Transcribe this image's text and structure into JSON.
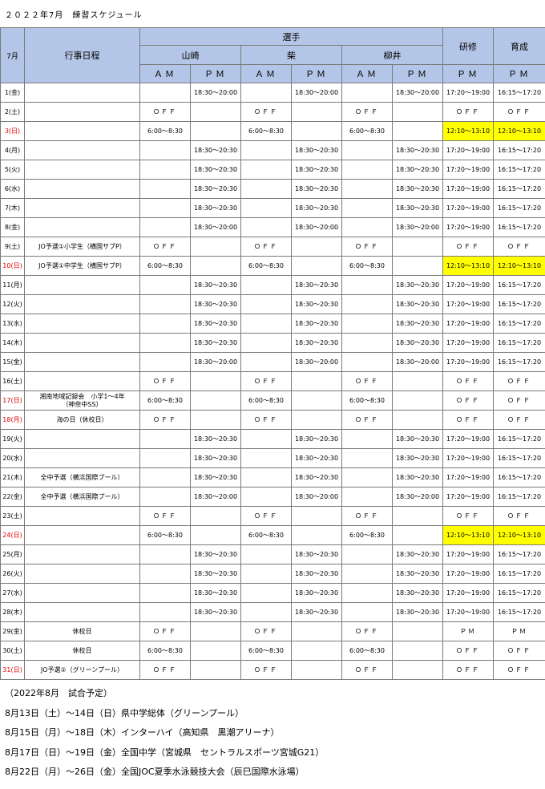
{
  "title": "２０２２年7月　練習スケジュール",
  "header": {
    "month": "7月",
    "events_col": "行事日程",
    "athletes": "選手",
    "names": [
      "山崎",
      "柴",
      "柳井"
    ],
    "training": "研修",
    "development": "育成",
    "am": "ＡＭ",
    "pm": "ＰＭ"
  },
  "rows": [
    {
      "date": "1(金)",
      "red": false,
      "event": "",
      "cells": [
        "",
        "18:30～20:00",
        "",
        "18:30～20:00",
        "",
        "18:30～20:00",
        "17:20～19:00",
        "16:15～17:20"
      ]
    },
    {
      "date": "2(土)",
      "red": false,
      "event": "",
      "cells": [
        "ＯＦＦ",
        "",
        "ＯＦＦ",
        "",
        "ＯＦＦ",
        "",
        "ＯＦＦ",
        "ＯＦＦ"
      ]
    },
    {
      "date": "3(日)",
      "red": true,
      "event": "",
      "cells": [
        "6:00～8:30",
        "",
        "6:00～8:30",
        "",
        "6:00～8:30",
        "",
        "12:10～13:10",
        "12:10～13:10"
      ],
      "yellow": true
    },
    {
      "date": "4(月)",
      "red": false,
      "event": "",
      "cells": [
        "",
        "18:30～20:30",
        "",
        "18:30～20:30",
        "",
        "18:30～20:30",
        "17:20～19:00",
        "16:15～17:20"
      ]
    },
    {
      "date": "5(火)",
      "red": false,
      "event": "",
      "cells": [
        "",
        "18:30～20:30",
        "",
        "18:30～20:30",
        "",
        "18:30～20:30",
        "17:20～19:00",
        "16:15～17:20"
      ]
    },
    {
      "date": "6(水)",
      "red": false,
      "event": "",
      "cells": [
        "",
        "18:30～20:30",
        "",
        "18:30～20:30",
        "",
        "18:30～20:30",
        "17:20～19:00",
        "16:15～17:20"
      ]
    },
    {
      "date": "7(木)",
      "red": false,
      "event": "",
      "cells": [
        "",
        "18:30～20:30",
        "",
        "18:30～20:30",
        "",
        "18:30～20:30",
        "17:20～19:00",
        "16:15～17:20"
      ]
    },
    {
      "date": "8(金)",
      "red": false,
      "event": "",
      "cells": [
        "",
        "18:30～20:00",
        "",
        "18:30～20:00",
        "",
        "18:30～20:00",
        "17:20～19:00",
        "16:15～17:20"
      ]
    },
    {
      "date": "9(土)",
      "red": false,
      "event": "JO予選①小学生（横国サブP）",
      "cells": [
        "ＯＦＦ",
        "",
        "ＯＦＦ",
        "",
        "ＯＦＦ",
        "",
        "ＯＦＦ",
        "ＯＦＦ"
      ]
    },
    {
      "date": "10(日)",
      "red": true,
      "event": "JO予選①中学生（横国サブP）",
      "cells": [
        "6:00～8:30",
        "",
        "6:00～8:30",
        "",
        "6:00～8:30",
        "",
        "12:10～13:10",
        "12:10～13:10"
      ],
      "yellow": true
    },
    {
      "date": "11(月)",
      "red": false,
      "event": "",
      "cells": [
        "",
        "18:30～20:30",
        "",
        "18:30～20:30",
        "",
        "18:30～20:30",
        "17:20～19:00",
        "16:15～17:20"
      ]
    },
    {
      "date": "12(火)",
      "red": false,
      "event": "",
      "cells": [
        "",
        "18:30～20:30",
        "",
        "18:30～20:30",
        "",
        "18:30～20:30",
        "17:20～19:00",
        "16:15～17:20"
      ]
    },
    {
      "date": "13(水)",
      "red": false,
      "event": "",
      "cells": [
        "",
        "18:30～20:30",
        "",
        "18:30～20:30",
        "",
        "18:30～20:30",
        "17:20～19:00",
        "16:15～17:20"
      ]
    },
    {
      "date": "14(木)",
      "red": false,
      "event": "",
      "cells": [
        "",
        "18:30～20:30",
        "",
        "18:30～20:30",
        "",
        "18:30～20:30",
        "17:20～19:00",
        "16:15～17:20"
      ]
    },
    {
      "date": "15(金)",
      "red": false,
      "event": "",
      "cells": [
        "",
        "18:30～20:00",
        "",
        "18:30～20:00",
        "",
        "18:30～20:00",
        "17:20～19:00",
        "16:15～17:20"
      ]
    },
    {
      "date": "16(土)",
      "red": false,
      "event": "",
      "cells": [
        "ＯＦＦ",
        "",
        "ＯＦＦ",
        "",
        "ＯＦＦ",
        "",
        "ＯＦＦ",
        "ＯＦＦ"
      ]
    },
    {
      "date": "17(日)",
      "red": true,
      "event": "湘南地域記録会　小学1～4年\n（神奈中SS）",
      "cells": [
        "6:00～8:30",
        "",
        "6:00～8:30",
        "",
        "6:00～8:30",
        "",
        "ＯＦＦ",
        "ＯＦＦ"
      ]
    },
    {
      "date": "18(月)",
      "red": true,
      "event": "海の日（休校日）",
      "cells": [
        "ＯＦＦ",
        "",
        "ＯＦＦ",
        "",
        "ＯＦＦ",
        "",
        "ＯＦＦ",
        "ＯＦＦ"
      ]
    },
    {
      "date": "19(火)",
      "red": false,
      "event": "",
      "cells": [
        "",
        "18:30～20:30",
        "",
        "18:30～20:30",
        "",
        "18:30～20:30",
        "17:20～19:00",
        "16:15～17:20"
      ]
    },
    {
      "date": "20(水)",
      "red": false,
      "event": "",
      "cells": [
        "",
        "18:30～20:30",
        "",
        "18:30～20:30",
        "",
        "18:30～20:30",
        "17:20～19:00",
        "16:15～17:20"
      ]
    },
    {
      "date": "21(木)",
      "red": false,
      "event": "全中予選（横浜国際プール）",
      "cells": [
        "",
        "18:30～20:30",
        "",
        "18:30～20:30",
        "",
        "18:30～20:30",
        "17:20～19:00",
        "16:15～17:20"
      ]
    },
    {
      "date": "22(金)",
      "red": false,
      "event": "全中予選（横浜国際プール）",
      "cells": [
        "",
        "18:30～20:00",
        "",
        "18:30～20:00",
        "",
        "18:30～20:00",
        "17:20～19:00",
        "16:15～17:20"
      ]
    },
    {
      "date": "23(土)",
      "red": false,
      "event": "",
      "cells": [
        "ＯＦＦ",
        "",
        "ＯＦＦ",
        "",
        "ＯＦＦ",
        "",
        "ＯＦＦ",
        "ＯＦＦ"
      ]
    },
    {
      "date": "24(日)",
      "red": true,
      "event": "",
      "cells": [
        "6:00～8:30",
        "",
        "6:00～8:30",
        "",
        "6:00～8:30",
        "",
        "12:10～13:10",
        "12:10～13:10"
      ],
      "yellow": true
    },
    {
      "date": "25(月)",
      "red": false,
      "event": "",
      "cells": [
        "",
        "18:30～20:30",
        "",
        "18:30～20:30",
        "",
        "18:30～20:30",
        "17:20～19:00",
        "16:15～17:20"
      ]
    },
    {
      "date": "26(火)",
      "red": false,
      "event": "",
      "cells": [
        "",
        "18:30～20:30",
        "",
        "18:30～20:30",
        "",
        "18:30～20:30",
        "17:20～19:00",
        "16:15～17:20"
      ]
    },
    {
      "date": "27(水)",
      "red": false,
      "event": "",
      "cells": [
        "",
        "18:30～20:30",
        "",
        "18:30～20:30",
        "",
        "18:30～20:30",
        "17:20～19:00",
        "16:15～17:20"
      ]
    },
    {
      "date": "28(木)",
      "red": false,
      "event": "",
      "cells": [
        "",
        "18:30～20:30",
        "",
        "18:30～20:30",
        "",
        "18:30～20:30",
        "17:20～19:00",
        "16:15～17:20"
      ]
    },
    {
      "date": "29(金)",
      "red": false,
      "event": "休校日",
      "cells": [
        "ＯＦＦ",
        "",
        "ＯＦＦ",
        "",
        "ＯＦＦ",
        "",
        "ＰＭ",
        "ＰＭ"
      ]
    },
    {
      "date": "30(土)",
      "red": false,
      "event": "休校日",
      "cells": [
        "6:00～8:30",
        "",
        "6:00～8:30",
        "",
        "6:00～8:30",
        "",
        "ＯＦＦ",
        "ＯＦＦ"
      ]
    },
    {
      "date": "31(日)",
      "red": true,
      "event": "JO予選②（グリーンプール）",
      "cells": [
        "ＯＦＦ",
        "",
        "ＯＦＦ",
        "",
        "ＯＦＦ",
        "",
        "ＯＦＦ",
        "ＯＦＦ"
      ]
    }
  ],
  "notes": [
    "（2022年8月　試合予定）",
    "8月13日（土）～14日（日）県中学総体（グリーンプール）",
    "8月15日（月）～18日（木）インターハイ（高知県　黒潮アリーナ）",
    "8月17日（日）～19日（金）全国中学（宮城県　セントラルスポーツ宮城G21）",
    "8月22日（月）～26日（金）全国JOC夏季水泳競技大会（辰巳国際水泳場）"
  ]
}
